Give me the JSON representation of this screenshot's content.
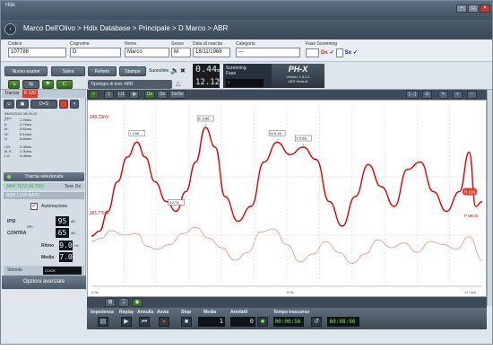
{
  "window": {
    "title": "Hdx"
  },
  "breadcrumb": "Marco Dell'Olivo > Hdix Database > Principale > D Marco > ABR",
  "patient": {
    "codice_label": "Codice",
    "codice": "107788",
    "cognome_label": "Cognome",
    "cognome": "D",
    "nome_label": "Nome",
    "nome": "Marco",
    "sesso_label": "Sesso",
    "sesso": "M",
    "nascita_label": "Data di nascita",
    "nascita": "18/11/1968",
    "categoria_label": "Categoria",
    "categoria": "---",
    "fase_label": "Fase Screening",
    "fase_dx": "Dx",
    "fase_sx": "Sx"
  },
  "toolbar": {
    "nuovo_esame": "Nuovo esame",
    "salva": "Salva",
    "referto": "Referto",
    "stampa": "Stampa",
    "suonoline": "Suonoline",
    "tipologia": "Tipologia di test:  ABR",
    "lcd_line1": "0.44",
    "lcd_line1_unit": "ms",
    "lcd_line2": "12.12",
    "lcd_line2_unit": "uV",
    "screening_title": "Screening",
    "screening_fase": "Fase",
    "screening_value": "-",
    "logo": "PH-X",
    "version": "Version 1.5.0.1",
    "module": "ABR Module"
  },
  "left": {
    "traccia_label": "Traccia",
    "traccia_badge": "R 120",
    "btn_dx": "D+S",
    "stamp": "08/01/2011 18:26:12",
    "tipo": "Tipo",
    "latencies": [
      {
        "wave": "I:",
        "value": "1.76ms"
      },
      {
        "wave": "II:",
        "value": "2.74ms"
      },
      {
        "wave": "III:",
        "value": "3.64ms"
      },
      {
        "wave": "IV:",
        "value": "5.14ms"
      },
      {
        "wave": "V:",
        "value": "5.66ms"
      }
    ],
    "intervals": [
      {
        "wave": "I-III:",
        "value": "2.08ms"
      },
      {
        "wave": "III-V:",
        "value": "2.00ms"
      },
      {
        "wave": "I-V:",
        "value": "4.08ms"
      }
    ],
    "traccia_sel": "Traccia selezionata",
    "test_label": "ABR TEST/ALTRO",
    "test_value": "Test: Dx",
    "low_rate": "ABR LOW RATE",
    "automazione": "Automazione",
    "ipsi": "IPSI",
    "contra": "CONTRA",
    "spl": "SPL",
    "ipsi_val": "95",
    "contra_val": "65",
    "ritmo_label": "Ritmo",
    "ritmo_val": "9.0",
    "ritmo_unit": "Hz",
    "media_label": "Media",
    "media_val": "7.0",
    "media_unit": "",
    "stimolo_label": "Stimolo",
    "stimolo_val": "CLICK",
    "opzioni": "Opzioni avanzate"
  },
  "chart_tools": {
    "dx": "Dx",
    "sx": "Sx",
    "dxsx": "Dx/Sx",
    "l1": "L/1"
  },
  "chart_data": {
    "type": "line",
    "xlabel": "",
    "ylabel": "",
    "xlim": [
      0,
      12
    ],
    "x_tick_labels": [
      "0.0s",
      "6.0s",
      "12.0ms"
    ],
    "trace1_label": "249.23nV",
    "trace2_label": "261.77nV",
    "trace1_end": "R 120",
    "trace2_end": "P 99/40",
    "series": [
      {
        "color": "#e00000",
        "x": [
          0,
          0.25,
          0.5,
          0.8,
          1.1,
          1.4,
          1.65,
          1.95,
          2.3,
          2.6,
          2.9,
          3.2,
          3.5,
          3.8,
          4.1,
          4.5,
          4.9,
          5.3,
          5.7,
          6.1,
          6.5,
          6.9,
          7.3,
          7.7,
          8.1,
          8.5,
          8.9,
          9.3,
          9.7,
          10.1,
          10.5,
          10.9,
          11.3,
          11.6,
          11.8,
          12.0
        ],
        "y": [
          -1.2,
          -1.1,
          -0.7,
          -0.1,
          0.4,
          0.7,
          0.4,
          -0.1,
          -0.5,
          -0.7,
          -0.3,
          0.3,
          1.0,
          0.6,
          -0.4,
          -0.9,
          -0.6,
          0.3,
          0.7,
          0.45,
          0.6,
          0.35,
          -0.5,
          -1.0,
          -0.4,
          0.25,
          -0.2,
          -0.6,
          0.15,
          0.3,
          -0.3,
          -0.7,
          -0.3,
          0.5,
          -0.6,
          -0.5
        ]
      },
      {
        "color": "#e8a098",
        "x": [
          0,
          0.3,
          0.6,
          1.0,
          1.4,
          1.7,
          2.0,
          2.4,
          2.8,
          3.2,
          3.6,
          4.0,
          4.4,
          4.8,
          5.2,
          5.6,
          6.0,
          6.4,
          6.8,
          7.2,
          7.6,
          8.0,
          8.4,
          8.8,
          9.2,
          9.6,
          10.0,
          10.4,
          10.8,
          11.2,
          11.6,
          12.0
        ],
        "y": [
          -0.2,
          -0.1,
          0.15,
          0.0,
          0.05,
          -0.35,
          -0.45,
          -0.3,
          0.05,
          0.25,
          -0.1,
          -0.4,
          -0.8,
          -0.55,
          0.1,
          0.2,
          -0.3,
          -0.85,
          -0.6,
          -0.2,
          -0.55,
          -0.9,
          -0.6,
          -0.15,
          -0.4,
          -0.25,
          -0.55,
          -0.2,
          -0.3,
          -0.45,
          -0.05,
          -0.8
        ]
      }
    ],
    "peak_labels": [
      {
        "text": "I 1.58",
        "x": 1.4,
        "y": 0.7
      },
      {
        "text": "II 2.74",
        "x": 2.6,
        "y": -0.7
      },
      {
        "text": "III 3.66",
        "x": 3.5,
        "y": 1.0
      },
      {
        "text": "IV 5.18",
        "x": 5.7,
        "y": 0.7
      },
      {
        "text": "V 5.66",
        "x": 6.5,
        "y": 0.6
      }
    ]
  },
  "controls": {
    "impedenza": "Impedenza",
    "replay": "Replay",
    "annulla": "Annulla",
    "avvia": "Avvia",
    "stop": "Stop",
    "media": "Media",
    "media_val": "1",
    "artefatti": "Artefatti",
    "artefatti_val": "0",
    "tempo": "Tempo trascorso",
    "tempo_val": "00:00:56",
    "counter_val": "60:08:96"
  }
}
